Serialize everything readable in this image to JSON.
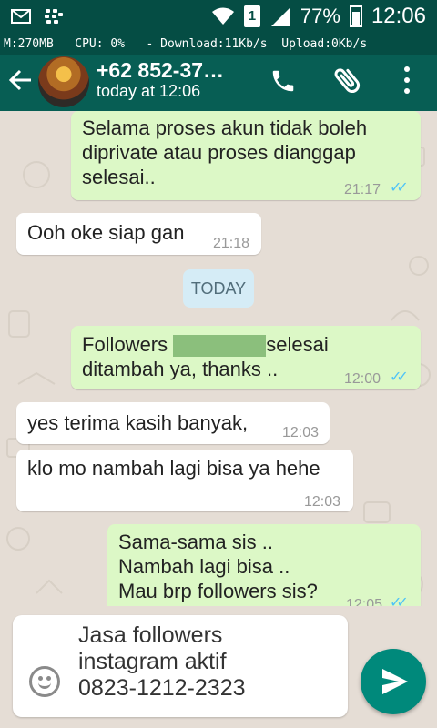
{
  "status_bar": {
    "battery_pct": "77%",
    "sim_label": "1",
    "time": "12:06",
    "monitor": "M:270MB   CPU: 0%   - Download:11Kb/s  Upload:0Kb/s"
  },
  "header": {
    "back_icon": "arrow-left-icon",
    "contact_name": "+62 852-37…",
    "last_seen": "today at 12:06",
    "icons": [
      "phone-icon",
      "paperclip-icon",
      "more-vert-icon"
    ]
  },
  "messages": [
    {
      "direction": "out",
      "lines": [
        "Selama proses akun tidak boleh",
        "diprivate atau proses dianggap",
        "selesai.."
      ],
      "time": "21:17",
      "read": true
    },
    {
      "direction": "in",
      "text": "Ooh oke siap gan",
      "time": "21:18"
    },
    {
      "direction": "out",
      "line1_before": "Followers",
      "line1_after": "selesai",
      "line2": "ditambah ya, thanks ..",
      "time": "12:00",
      "read": true
    },
    {
      "direction": "in",
      "text": "yes terima kasih banyak,",
      "time": "12:03"
    },
    {
      "direction": "in",
      "text": "klo mo nambah lagi bisa ya hehe",
      "time": "12:03"
    },
    {
      "direction": "out",
      "lines": [
        "Sama-sama sis ..",
        "Nambah lagi bisa ..",
        "Mau brp followers sis?"
      ],
      "time": "12:05",
      "read": true
    }
  ],
  "date_divider": "TODAY",
  "composer": {
    "text": "Jasa followers\ninstagram aktif\n0823-1212-2323",
    "emoji_icon": "emoji-icon",
    "send_icon": "send-icon"
  },
  "colors": {
    "status_bar": "#054d44",
    "app_bar": "#075e54",
    "outgoing_bubble": "#dcf8c6",
    "incoming_bubble": "#ffffff",
    "chat_background": "#e5ddd5",
    "read_ticks": "#4fc3f7",
    "send_button": "#00897b"
  }
}
